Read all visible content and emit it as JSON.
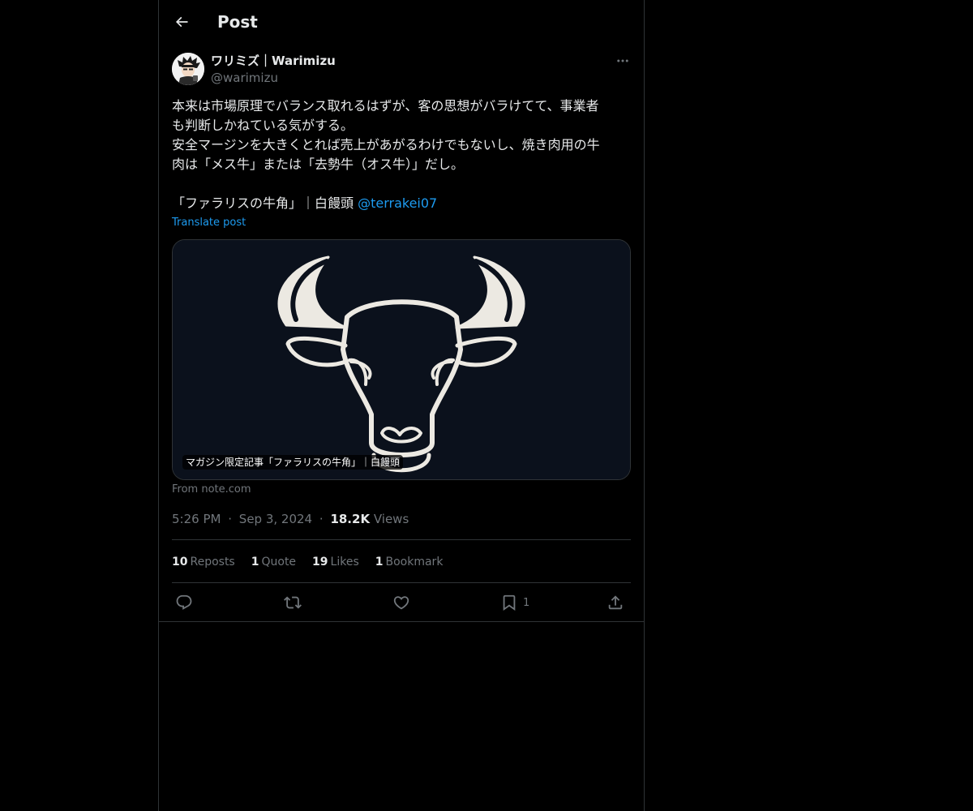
{
  "header": {
    "title": "Post",
    "back_icon": "arrow-left-icon"
  },
  "author": {
    "display_name": "ワリミズ｜Warimizu",
    "handle": "@warimizu"
  },
  "post": {
    "text_1": "本来は市場原理でバランス取れるはずが、客の思想がバラけてて、事業者\nも判断しかねている気がする。\n安全マージンを大きくとれば売上があがるわけでもないし、焼き肉用の牛\n肉は「メス牛」または「去勢牛（オス牛）」だし。\n\n「ファラリスの牛角」｜白饅頭 ",
    "mention": "@terrakei07",
    "translate": "Translate post"
  },
  "card": {
    "caption": "マガジン限定記事「ファラリスの牛角」｜白饅頭",
    "source": "From note.com"
  },
  "meta": {
    "time": "5:26 PM",
    "date": "Sep 3, 2024",
    "views_count": "18.2K",
    "views_label": "Views",
    "separator": "·"
  },
  "stats": [
    {
      "count": "10",
      "label": "Reposts"
    },
    {
      "count": "1",
      "label": "Quote"
    },
    {
      "count": "19",
      "label": "Likes"
    },
    {
      "count": "1",
      "label": "Bookmark"
    }
  ],
  "actions": {
    "bookmark_count": "1"
  },
  "colors": {
    "background": "#000000",
    "text": "#e7e9ea",
    "muted": "#71767b",
    "accent": "#1d9bf0",
    "border": "#2f3336"
  }
}
